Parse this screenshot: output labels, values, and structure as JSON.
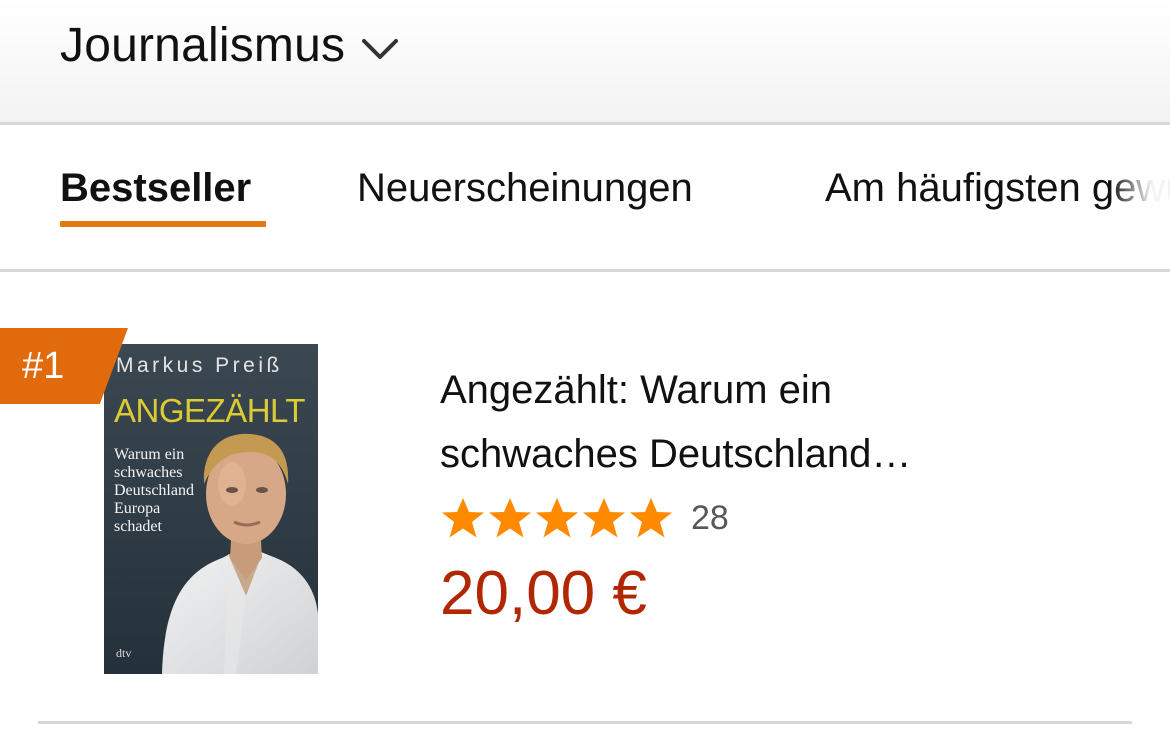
{
  "category": {
    "title": "Journalismus"
  },
  "tabs": [
    {
      "label": "Bestseller",
      "active": true
    },
    {
      "label": "Neuerscheinungen",
      "active": false
    },
    {
      "label": "Am häufigsten gewünscht",
      "active": false
    }
  ],
  "product": {
    "rank": "#1",
    "title": "Angezählt: Warum ein schwaches Deutschland…",
    "rating": 5,
    "rating_max": 5,
    "review_count": "28",
    "price": "20,00 €",
    "cover": {
      "author": "Markus Preiß",
      "title": "ANGEZÄHLT",
      "subtitle": "Warum ein\nschwaches\nDeutschland\nEuropa\nschadet",
      "publisher": "dtv"
    }
  },
  "colors": {
    "accent": "#e47911",
    "badge": "#e06a0c",
    "price": "#b12704",
    "star": "#ff8a00",
    "review_count": "#565959"
  },
  "icons": {
    "dropdown": "chevron-down-icon",
    "rating": "star-icon"
  }
}
